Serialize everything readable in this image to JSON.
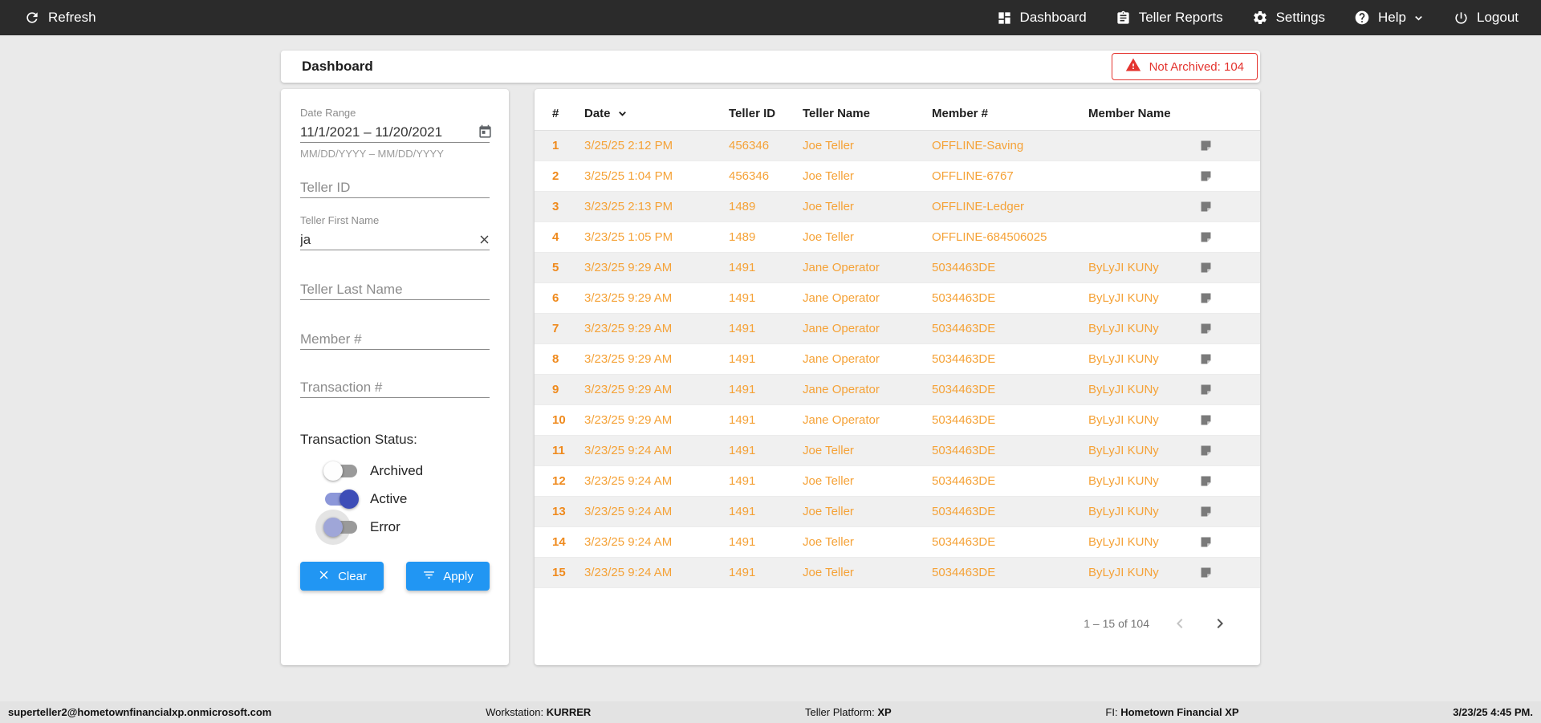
{
  "nav": {
    "refresh_label": "Refresh",
    "dashboard_label": "Dashboard",
    "teller_reports_label": "Teller Reports",
    "settings_label": "Settings",
    "help_label": "Help",
    "logout_label": "Logout"
  },
  "header": {
    "title": "Dashboard",
    "not_archived_badge": "Not Archived: 104"
  },
  "filters": {
    "date_range": {
      "label": "Date Range",
      "value": "11/1/2021 – 11/20/2021",
      "hint": "MM/DD/YYYY – MM/DD/YYYY"
    },
    "teller_id": {
      "placeholder": "Teller ID",
      "value": ""
    },
    "teller_first_name": {
      "label": "Teller First Name",
      "value": "ja"
    },
    "teller_last_name": {
      "placeholder": "Teller Last Name",
      "value": ""
    },
    "member_number": {
      "placeholder": "Member #",
      "value": ""
    },
    "transaction_number": {
      "placeholder": "Transaction #",
      "value": ""
    },
    "status_section_label": "Transaction Status:",
    "toggles": [
      {
        "label": "Archived",
        "state": "off"
      },
      {
        "label": "Active",
        "state": "on"
      },
      {
        "label": "Error",
        "state": "off"
      }
    ],
    "clear_button": "Clear",
    "apply_button": "Apply"
  },
  "table": {
    "columns": {
      "num": "#",
      "date": "Date",
      "teller_id": "Teller ID",
      "teller_name": "Teller Name",
      "member_num": "Member #",
      "member_name": "Member Name"
    },
    "sort_column": "Date",
    "rows": [
      {
        "num": "1",
        "date": "3/25/25 2:12 PM",
        "teller_id": "456346",
        "teller_name": "Joe Teller",
        "member_num": "OFFLINE-Saving",
        "member_name": ""
      },
      {
        "num": "2",
        "date": "3/25/25 1:04 PM",
        "teller_id": "456346",
        "teller_name": "Joe Teller",
        "member_num": "OFFLINE-6767",
        "member_name": ""
      },
      {
        "num": "3",
        "date": "3/23/25 2:13 PM",
        "teller_id": "1489",
        "teller_name": "Joe Teller",
        "member_num": "OFFLINE-Ledger",
        "member_name": ""
      },
      {
        "num": "4",
        "date": "3/23/25 1:05 PM",
        "teller_id": "1489",
        "teller_name": "Joe Teller",
        "member_num": "OFFLINE-684506025",
        "member_name": ""
      },
      {
        "num": "5",
        "date": "3/23/25 9:29 AM",
        "teller_id": "1491",
        "teller_name": "Jane Operator",
        "member_num": "5034463DE",
        "member_name": "ByLyJI KUNy"
      },
      {
        "num": "6",
        "date": "3/23/25 9:29 AM",
        "teller_id": "1491",
        "teller_name": "Jane Operator",
        "member_num": "5034463DE",
        "member_name": "ByLyJI KUNy"
      },
      {
        "num": "7",
        "date": "3/23/25 9:29 AM",
        "teller_id": "1491",
        "teller_name": "Jane Operator",
        "member_num": "5034463DE",
        "member_name": "ByLyJI KUNy"
      },
      {
        "num": "8",
        "date": "3/23/25 9:29 AM",
        "teller_id": "1491",
        "teller_name": "Jane Operator",
        "member_num": "5034463DE",
        "member_name": "ByLyJI KUNy"
      },
      {
        "num": "9",
        "date": "3/23/25 9:29 AM",
        "teller_id": "1491",
        "teller_name": "Jane Operator",
        "member_num": "5034463DE",
        "member_name": "ByLyJI KUNy"
      },
      {
        "num": "10",
        "date": "3/23/25 9:29 AM",
        "teller_id": "1491",
        "teller_name": "Jane Operator",
        "member_num": "5034463DE",
        "member_name": "ByLyJI KUNy"
      },
      {
        "num": "11",
        "date": "3/23/25 9:24 AM",
        "teller_id": "1491",
        "teller_name": "Joe Teller",
        "member_num": "5034463DE",
        "member_name": "ByLyJI KUNy"
      },
      {
        "num": "12",
        "date": "3/23/25 9:24 AM",
        "teller_id": "1491",
        "teller_name": "Joe Teller",
        "member_num": "5034463DE",
        "member_name": "ByLyJI KUNy"
      },
      {
        "num": "13",
        "date": "3/23/25 9:24 AM",
        "teller_id": "1491",
        "teller_name": "Joe Teller",
        "member_num": "5034463DE",
        "member_name": "ByLyJI KUNy"
      },
      {
        "num": "14",
        "date": "3/23/25 9:24 AM",
        "teller_id": "1491",
        "teller_name": "Joe Teller",
        "member_num": "5034463DE",
        "member_name": "ByLyJI KUNy"
      },
      {
        "num": "15",
        "date": "3/23/25 9:24 AM",
        "teller_id": "1491",
        "teller_name": "Joe Teller",
        "member_num": "5034463DE",
        "member_name": "ByLyJI KUNy"
      }
    ],
    "pagination": {
      "range_label": "1 – 15 of 104"
    }
  },
  "footer": {
    "user_email": "superteller2@hometownfinancialxp.onmicrosoft.com",
    "workstation_label": "Workstation:",
    "workstation_value": "KURRER",
    "platform_label": "Teller Platform:",
    "platform_value": "XP",
    "fi_label": "FI:",
    "fi_value": "Hometown Financial XP",
    "datetime": "3/23/25 4:45 PM."
  },
  "colors": {
    "nav_bg": "#2b2b2b",
    "accent_blue": "#2196f3",
    "row_orange": "#f5a237",
    "alert_red": "#e4342f",
    "toggle_indigo": "#3d4db7"
  }
}
